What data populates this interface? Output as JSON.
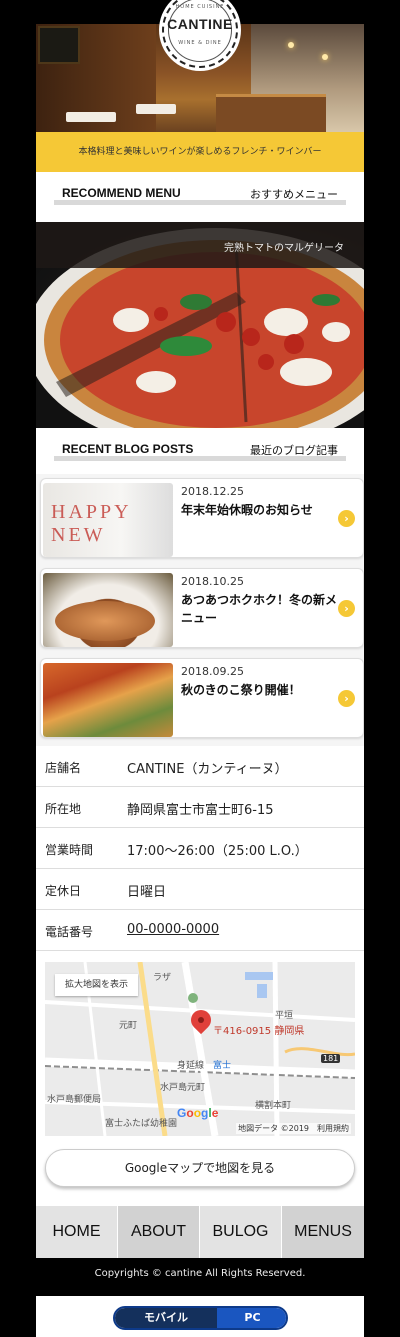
{
  "logo": {
    "name": "CANTINE",
    "sub_top": "HOME CUISINE",
    "sub_bottom": "WINE & DINE"
  },
  "tagline": "本格料理と美味しいワインが楽しめるフレンチ・ワインバー",
  "recommend": {
    "heading_en": "RECOMMEND MENU",
    "heading_jp": "おすすめメニュー",
    "caption": "完熟トマトのマルゲリータ"
  },
  "blog": {
    "heading_en": "RECENT BLOG POSTS",
    "heading_jp": "最近のブログ記事",
    "posts": [
      {
        "date": "2018.12.25",
        "title": "年末年始休暇のお知らせ",
        "thumb_text": "HAPPY NEW"
      },
      {
        "date": "2018.10.25",
        "title": "あつあつホクホク！冬の新メニュー"
      },
      {
        "date": "2018.09.25",
        "title": "秋のきのこ祭り開催！"
      }
    ]
  },
  "info": [
    {
      "key": "店舗名",
      "value": "CANTINE（カンティーヌ）"
    },
    {
      "key": "所在地",
      "value": "静岡県富士市富士町6-15"
    },
    {
      "key": "営業時間",
      "value": "17:00〜26:00（25:00 L.O.）"
    },
    {
      "key": "定休日",
      "value": "日曜日"
    },
    {
      "key": "電話番号",
      "value": "00-0000-0000"
    }
  ],
  "map": {
    "enlarge_label": "拡大地図を表示",
    "address_label": "〒416-0915 静岡県",
    "labels": [
      "ラザ",
      "元町",
      "平垣",
      "身延線",
      "富士",
      "水戸島元町",
      "水戸島郵便局",
      "横割本町",
      "富士ふたば幼稚園",
      "181"
    ],
    "google": "Google",
    "footer": "地図データ ©2019　利用規約"
  },
  "gmap_button": "Googleマップで地図を見る",
  "nav": [
    "HOME",
    "ABOUT",
    "BULOG",
    "MENUS"
  ],
  "copyright": "Copyrights © cantine All Rights Reserved.",
  "switch": {
    "mobile": "モバイル",
    "pc": "PC"
  },
  "colors": {
    "accent": "#f5c836",
    "nav_bg": "#e3e3e3",
    "switch_mobile": "#14305c",
    "switch_pc": "#1a56c0"
  }
}
